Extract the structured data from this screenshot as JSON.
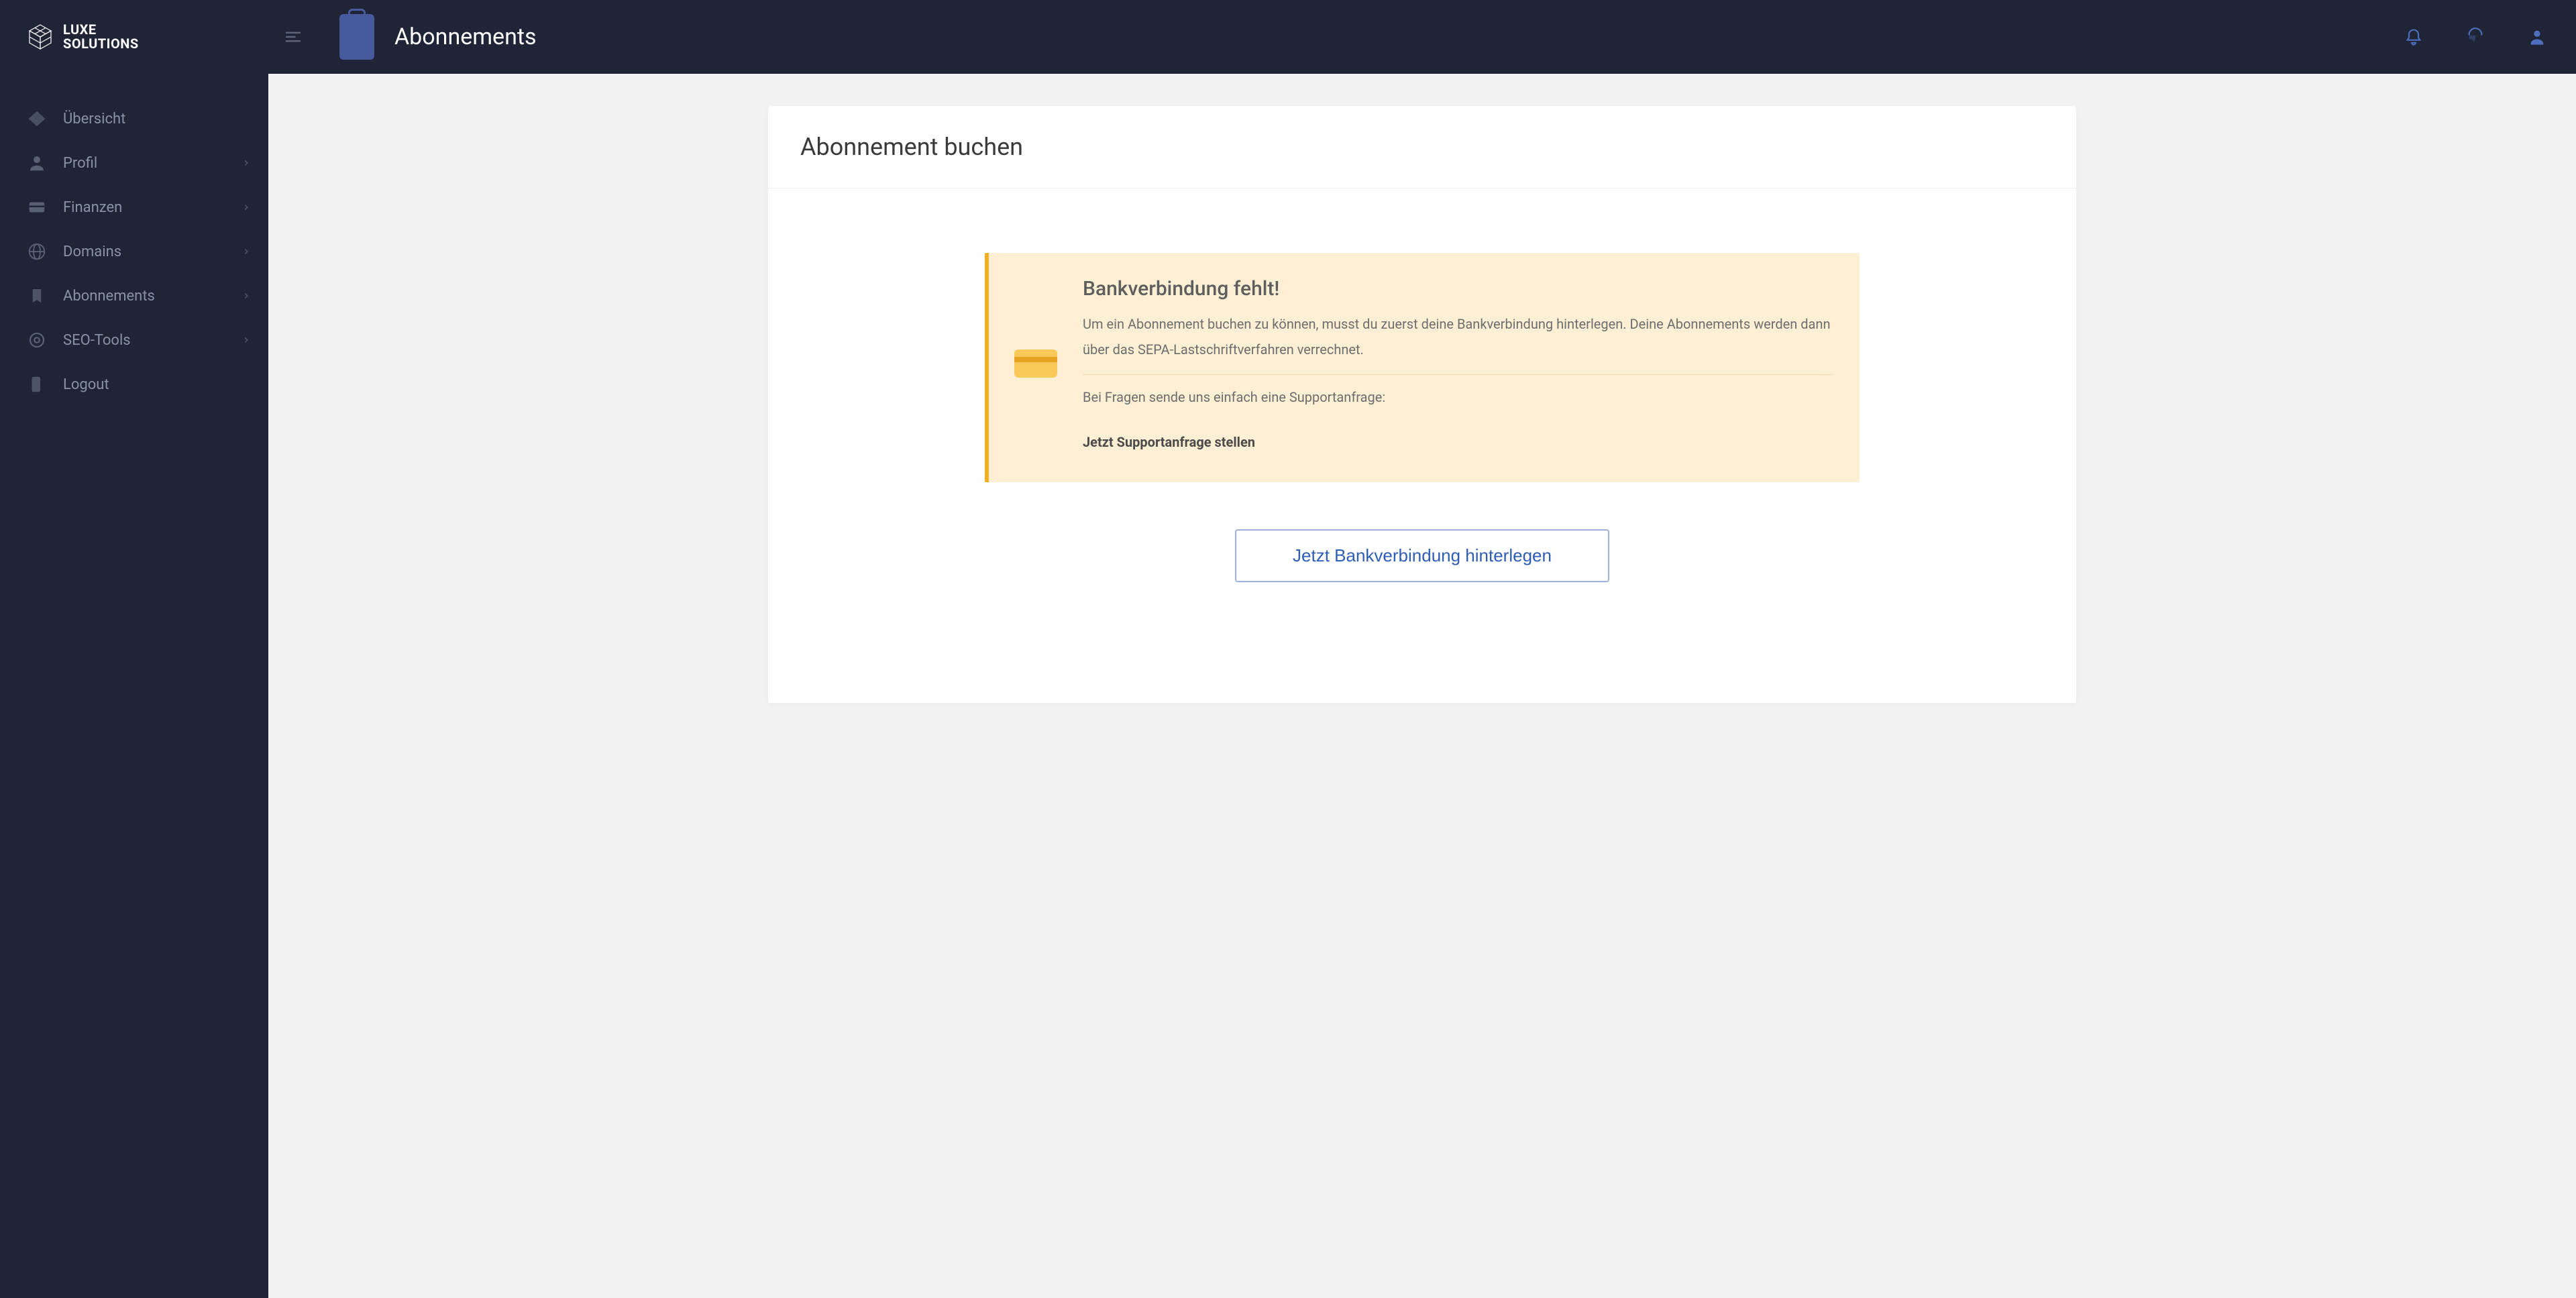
{
  "app": {
    "logo_line1": "LUXE",
    "logo_line2": "SOLUTIONS"
  },
  "topbar": {
    "page_title": "Abonnements"
  },
  "sidebar": {
    "items": [
      {
        "label": "Übersicht",
        "icon": "overview",
        "has_children": false
      },
      {
        "label": "Profil",
        "icon": "profile",
        "has_children": true
      },
      {
        "label": "Finanzen",
        "icon": "finance",
        "has_children": true
      },
      {
        "label": "Domains",
        "icon": "domains",
        "has_children": true
      },
      {
        "label": "Abonnements",
        "icon": "subscriptions",
        "has_children": true
      },
      {
        "label": "SEO-Tools",
        "icon": "seo",
        "has_children": true
      },
      {
        "label": "Logout",
        "icon": "logout",
        "has_children": false
      }
    ]
  },
  "card": {
    "heading": "Abonnement buchen",
    "callout": {
      "title": "Bankverbindung fehlt!",
      "text": "Um ein Abonnement buchen zu können, musst du zuerst deine Bankverbindung hinterlegen. Deine Abonnements werden dann über das SEPA-Lastschriftverfahren verrechnet.",
      "footer_text": "Bei Fragen sende uns einfach eine Supportanfrage:",
      "link_label": "Jetzt Supportanfrage stellen"
    },
    "action_button": "Jetzt Bankverbindung hinterlegen"
  }
}
